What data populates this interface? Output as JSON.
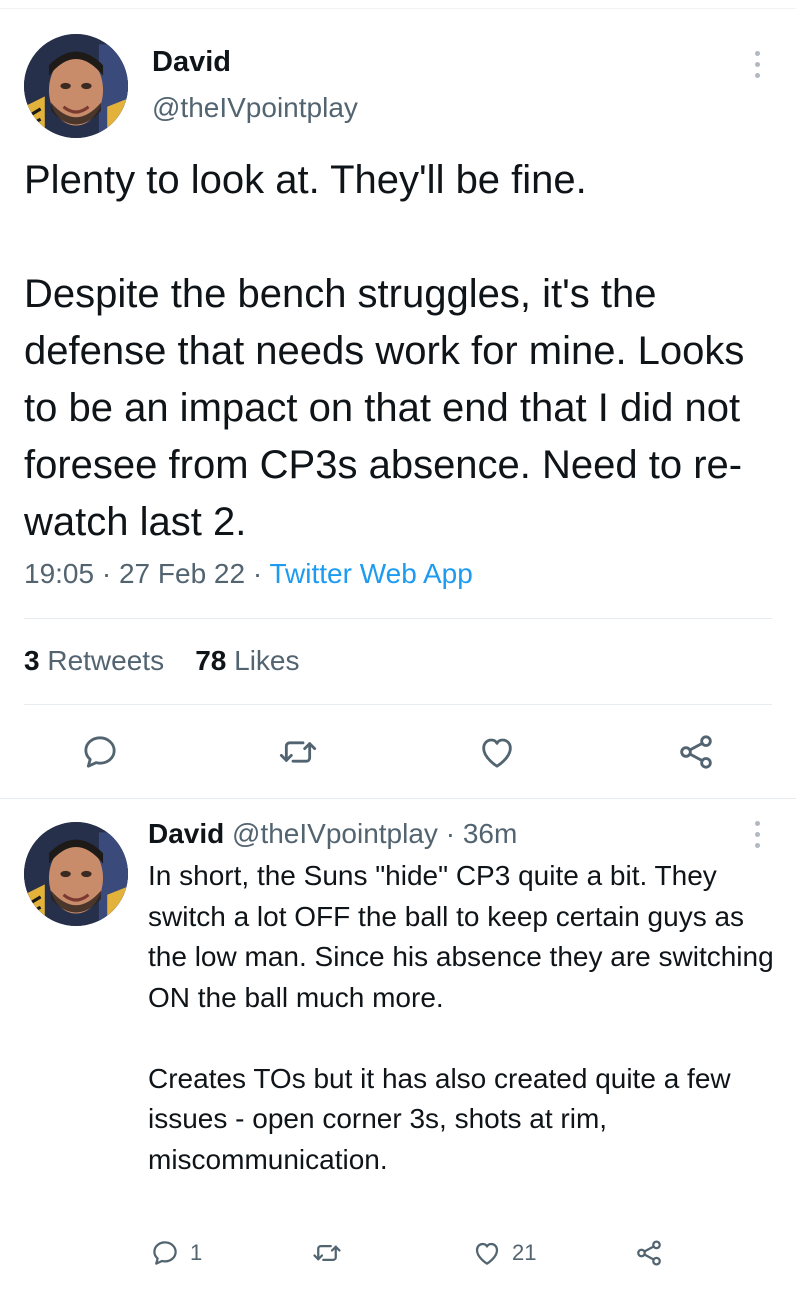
{
  "tweet": {
    "author_name": "David",
    "author_handle": "@theIVpointplay",
    "text": "Plenty to look at. They'll be fine.\n\nDespite the bench struggles, it's the defense that needs work for mine. Looks to be an impact on that end that I did not foresee from CP3s absence. Need to re-watch last 2.",
    "time": "19:05",
    "date": "27 Feb 22",
    "separator": "·",
    "source_app": "Twitter Web App",
    "retweet_count": "3",
    "retweet_label": "Retweets",
    "like_count": "78",
    "like_label": "Likes"
  },
  "reply": {
    "author_name": "David",
    "author_handle": "@theIVpointplay",
    "separator": "·",
    "time_ago": "36m",
    "text": "In short, the Suns \"hide\" CP3 quite a bit. They switch a lot OFF the ball to keep certain guys as the low man. Since his absence they are switching ON the ball much more.\n\nCreates TOs but it has also created quite a few issues - open corner 3s, shots at rim, miscommunication.",
    "reply_count": "1",
    "like_count": "21"
  },
  "icons": {
    "reply": "reply-bubble-icon",
    "retweet": "retweet-icon",
    "like": "heart-icon",
    "share": "share-icon",
    "more": "more-vertical-icon"
  },
  "colors": {
    "text": "#0f1419",
    "secondary": "#536471",
    "link": "#1d9bf0",
    "divider": "#e6ecf0"
  }
}
